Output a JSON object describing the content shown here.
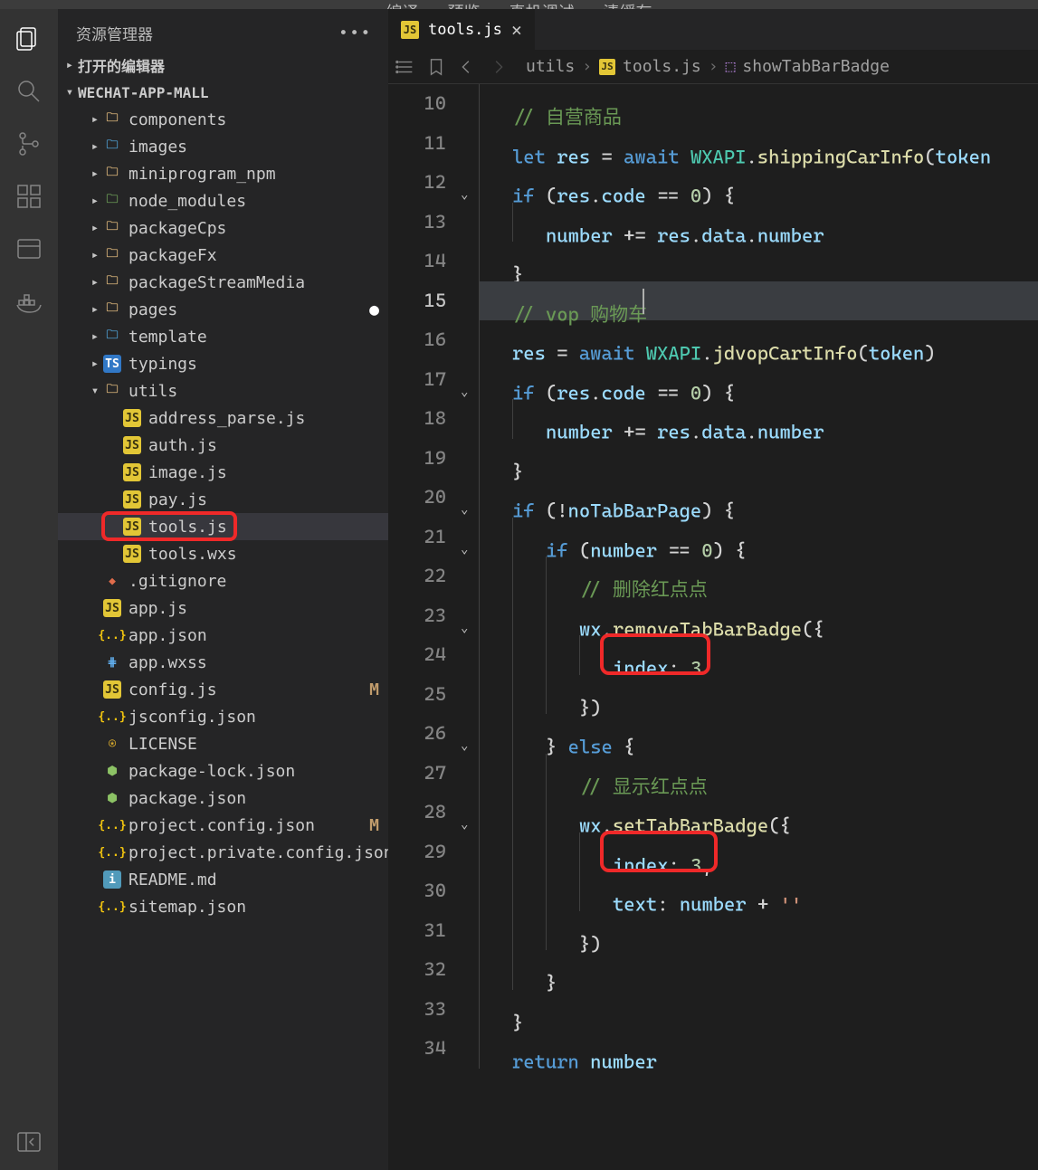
{
  "topmenu": [
    "编译",
    "预览",
    "真机调试",
    "清缓存"
  ],
  "sidebar": {
    "title": "资源管理器",
    "sections": {
      "open_editors": "打开的编辑器",
      "project": "WECHAT-APP-MALL"
    },
    "tree": [
      {
        "d": 1,
        "t": "folder",
        "c": "caret-right",
        "i": "fi-folder",
        "l": "components"
      },
      {
        "d": 1,
        "t": "folder",
        "c": "caret-right",
        "i": "fi-folder-blue",
        "l": "images"
      },
      {
        "d": 1,
        "t": "folder",
        "c": "caret-right",
        "i": "fi-folder",
        "l": "miniprogram_npm"
      },
      {
        "d": 1,
        "t": "folder",
        "c": "caret-right",
        "i": "fi-folder-green",
        "l": "node_modules"
      },
      {
        "d": 1,
        "t": "folder",
        "c": "caret-right",
        "i": "fi-folder",
        "l": "packageCps"
      },
      {
        "d": 1,
        "t": "folder",
        "c": "caret-right",
        "i": "fi-folder",
        "l": "packageFx"
      },
      {
        "d": 1,
        "t": "folder",
        "c": "caret-right",
        "i": "fi-folder",
        "l": "packageStreamMedia"
      },
      {
        "d": 1,
        "t": "folder",
        "c": "caret-right",
        "i": "fi-folder",
        "l": "pages",
        "dot": true
      },
      {
        "d": 1,
        "t": "folder",
        "c": "caret-right",
        "i": "fi-folder-blue",
        "l": "template"
      },
      {
        "d": 1,
        "t": "folder",
        "c": "caret-right",
        "i": "fi-ts",
        "l": "typings"
      },
      {
        "d": 1,
        "t": "folder",
        "c": "caret-down",
        "i": "fi-folder",
        "l": "utils"
      },
      {
        "d": 2,
        "t": "file",
        "i": "fi-js",
        "l": "address_parse.js"
      },
      {
        "d": 2,
        "t": "file",
        "i": "fi-js",
        "l": "auth.js"
      },
      {
        "d": 2,
        "t": "file",
        "i": "fi-js",
        "l": "image.js"
      },
      {
        "d": 2,
        "t": "file",
        "i": "fi-js",
        "l": "pay.js"
      },
      {
        "d": 2,
        "t": "file",
        "i": "fi-js",
        "l": "tools.js",
        "active": true,
        "hlbox": true
      },
      {
        "d": 2,
        "t": "file",
        "i": "fi-js",
        "l": "tools.wxs"
      },
      {
        "d": 1,
        "t": "file",
        "i": "fi-git",
        "l": ".gitignore"
      },
      {
        "d": 1,
        "t": "file",
        "i": "fi-js",
        "l": "app.js"
      },
      {
        "d": 1,
        "t": "file",
        "i": "fi-json",
        "l": "app.json"
      },
      {
        "d": 1,
        "t": "file",
        "i": "fi-css",
        "l": "app.wxss"
      },
      {
        "d": 1,
        "t": "file",
        "i": "fi-js",
        "l": "config.js",
        "status": "M"
      },
      {
        "d": 1,
        "t": "file",
        "i": "fi-json",
        "l": "jsconfig.json"
      },
      {
        "d": 1,
        "t": "file",
        "i": "fi-lic",
        "l": "LICENSE"
      },
      {
        "d": 1,
        "t": "file",
        "i": "fi-npm",
        "l": "package-lock.json"
      },
      {
        "d": 1,
        "t": "file",
        "i": "fi-npm",
        "l": "package.json"
      },
      {
        "d": 1,
        "t": "file",
        "i": "fi-json",
        "l": "project.config.json",
        "status": "M"
      },
      {
        "d": 1,
        "t": "file",
        "i": "fi-json",
        "l": "project.private.config.json"
      },
      {
        "d": 1,
        "t": "file",
        "i": "fi-info",
        "l": "README.md"
      },
      {
        "d": 1,
        "t": "file",
        "i": "fi-json",
        "l": "sitemap.json"
      }
    ]
  },
  "editor": {
    "tab": {
      "file": "tools.js"
    },
    "breadcrumb": [
      "utils",
      "tools.js",
      "showTabBarBadge"
    ],
    "current_line": 15,
    "lines": [
      {
        "n": 10,
        "ind": 1,
        "seg": [
          [
            "cm",
            "// 自营商品"
          ]
        ]
      },
      {
        "n": 11,
        "ind": 1,
        "seg": [
          [
            "kw",
            "let"
          ],
          [
            "p",
            " "
          ],
          [
            "var",
            "res"
          ],
          [
            "p",
            " "
          ],
          [
            "op",
            "="
          ],
          [
            "p",
            " "
          ],
          [
            "kw",
            "await"
          ],
          [
            "p",
            " "
          ],
          [
            "obj",
            "WXAPI"
          ],
          [
            "p",
            "."
          ],
          [
            "fn",
            "shippingCarInfo"
          ],
          [
            "p",
            "("
          ],
          [
            "var",
            "token"
          ]
        ]
      },
      {
        "n": 12,
        "ind": 1,
        "fold": true,
        "seg": [
          [
            "kw",
            "if"
          ],
          [
            "p",
            " ("
          ],
          [
            "var",
            "res"
          ],
          [
            "p",
            "."
          ],
          [
            "var",
            "code"
          ],
          [
            "p",
            " "
          ],
          [
            "op",
            "=="
          ],
          [
            "p",
            " "
          ],
          [
            "num",
            "0"
          ],
          [
            "p",
            ") {"
          ]
        ]
      },
      {
        "n": 13,
        "ind": 2,
        "seg": [
          [
            "var",
            "number"
          ],
          [
            "p",
            " "
          ],
          [
            "op",
            "+="
          ],
          [
            "p",
            " "
          ],
          [
            "var",
            "res"
          ],
          [
            "p",
            "."
          ],
          [
            "var",
            "data"
          ],
          [
            "p",
            "."
          ],
          [
            "var",
            "number"
          ]
        ]
      },
      {
        "n": 14,
        "ind": 1,
        "seg": [
          [
            "p",
            "}"
          ]
        ]
      },
      {
        "n": 15,
        "ind": 1,
        "current": true,
        "seg": [
          [
            "cm",
            "// vop 购物车"
          ]
        ],
        "cursor": 144
      },
      {
        "n": 16,
        "ind": 1,
        "seg": [
          [
            "var",
            "res"
          ],
          [
            "p",
            " "
          ],
          [
            "op",
            "="
          ],
          [
            "p",
            " "
          ],
          [
            "kw",
            "await"
          ],
          [
            "p",
            " "
          ],
          [
            "obj",
            "WXAPI"
          ],
          [
            "p",
            "."
          ],
          [
            "fn",
            "jdvopCartInfo"
          ],
          [
            "p",
            "("
          ],
          [
            "var",
            "token"
          ],
          [
            "p",
            ")"
          ]
        ]
      },
      {
        "n": 17,
        "ind": 1,
        "fold": true,
        "seg": [
          [
            "kw",
            "if"
          ],
          [
            "p",
            " ("
          ],
          [
            "var",
            "res"
          ],
          [
            "p",
            "."
          ],
          [
            "var",
            "code"
          ],
          [
            "p",
            " "
          ],
          [
            "op",
            "=="
          ],
          [
            "p",
            " "
          ],
          [
            "num",
            "0"
          ],
          [
            "p",
            ") {"
          ]
        ]
      },
      {
        "n": 18,
        "ind": 2,
        "seg": [
          [
            "var",
            "number"
          ],
          [
            "p",
            " "
          ],
          [
            "op",
            "+="
          ],
          [
            "p",
            " "
          ],
          [
            "var",
            "res"
          ],
          [
            "p",
            "."
          ],
          [
            "var",
            "data"
          ],
          [
            "p",
            "."
          ],
          [
            "var",
            "number"
          ]
        ]
      },
      {
        "n": 19,
        "ind": 1,
        "seg": [
          [
            "p",
            "}"
          ]
        ]
      },
      {
        "n": 20,
        "ind": 1,
        "fold": true,
        "seg": [
          [
            "kw",
            "if"
          ],
          [
            "p",
            " ("
          ],
          [
            "op",
            "!"
          ],
          [
            "var",
            "noTabBarPage"
          ],
          [
            "p",
            ") {"
          ]
        ]
      },
      {
        "n": 21,
        "ind": 2,
        "fold": true,
        "seg": [
          [
            "kw",
            "if"
          ],
          [
            "p",
            " ("
          ],
          [
            "var",
            "number"
          ],
          [
            "p",
            " "
          ],
          [
            "op",
            "=="
          ],
          [
            "p",
            " "
          ],
          [
            "num",
            "0"
          ],
          [
            "p",
            ") {"
          ]
        ]
      },
      {
        "n": 22,
        "ind": 3,
        "seg": [
          [
            "cm",
            "// 删除红点点"
          ]
        ]
      },
      {
        "n": 23,
        "ind": 3,
        "fold": true,
        "seg": [
          [
            "var",
            "wx"
          ],
          [
            "p",
            "."
          ],
          [
            "fn",
            "removeTabBarBadge"
          ],
          [
            "p",
            "({"
          ]
        ]
      },
      {
        "n": 24,
        "ind": 4,
        "redbox": true,
        "seg": [
          [
            "var",
            "index"
          ],
          [
            "p",
            ": "
          ],
          [
            "num",
            "3"
          ]
        ]
      },
      {
        "n": 25,
        "ind": 3,
        "seg": [
          [
            "p",
            "})"
          ]
        ]
      },
      {
        "n": 26,
        "ind": 2,
        "fold": true,
        "seg": [
          [
            "p",
            "} "
          ],
          [
            "kw",
            "else"
          ],
          [
            "p",
            " {"
          ]
        ]
      },
      {
        "n": 27,
        "ind": 3,
        "seg": [
          [
            "cm",
            "// 显示红点点"
          ]
        ]
      },
      {
        "n": 28,
        "ind": 3,
        "fold": true,
        "seg": [
          [
            "var",
            "wx"
          ],
          [
            "p",
            "."
          ],
          [
            "fn",
            "setTabBarBadge"
          ],
          [
            "p",
            "({"
          ]
        ]
      },
      {
        "n": 29,
        "ind": 4,
        "redbox": true,
        "rbw": 130,
        "seg": [
          [
            "var",
            "index"
          ],
          [
            "p",
            ": "
          ],
          [
            "num",
            "3"
          ],
          [
            "p",
            ","
          ]
        ]
      },
      {
        "n": 30,
        "ind": 4,
        "seg": [
          [
            "var",
            "text"
          ],
          [
            "p",
            ": "
          ],
          [
            "var",
            "number"
          ],
          [
            "p",
            " "
          ],
          [
            "op",
            "+"
          ],
          [
            "p",
            " "
          ],
          [
            "str",
            "''"
          ]
        ]
      },
      {
        "n": 31,
        "ind": 3,
        "seg": [
          [
            "p",
            "})"
          ]
        ]
      },
      {
        "n": 32,
        "ind": 2,
        "seg": [
          [
            "p",
            "}"
          ]
        ]
      },
      {
        "n": 33,
        "ind": 1,
        "seg": [
          [
            "p",
            "}"
          ]
        ]
      },
      {
        "n": 34,
        "ind": 1,
        "seg": [
          [
            "kw",
            "return"
          ],
          [
            "p",
            " "
          ],
          [
            "var",
            "number"
          ]
        ]
      }
    ]
  }
}
